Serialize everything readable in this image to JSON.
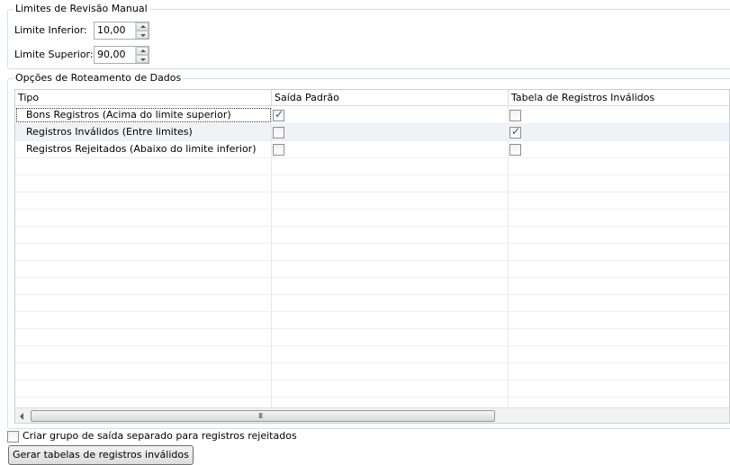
{
  "manual_review": {
    "title": "Limites de Revisão Manual",
    "lower_label": "Limite Inferior:",
    "lower_value": "10,00",
    "upper_label": "Limite Superior:",
    "upper_value": "90,00"
  },
  "routing": {
    "title": "Opções de Roteamento de Dados",
    "columns": [
      "Tipo",
      "Saída Padrão",
      "Tabela de Registros Inválidos"
    ],
    "rows": [
      {
        "type": "Bons Registros (Acima do limite superior)",
        "default_output": true,
        "invalid_table": false
      },
      {
        "type": "Registros Inválidos (Entre limites)",
        "default_output": false,
        "invalid_table": true
      },
      {
        "type": "Registros Rejeitados (Abaixo do limite inferior)",
        "default_output": false,
        "invalid_table": false
      }
    ],
    "scroll_grip": "III"
  },
  "separate_group": {
    "label": "Criar grupo de saída separado para registros rejeitados",
    "checked": false
  },
  "generate_button": "Gerar tabelas de registros inválidos",
  "colors": {
    "selected_row": "#eef3f8",
    "group_border": "#d5dfe5",
    "check_mark": "#2c5d8f"
  }
}
